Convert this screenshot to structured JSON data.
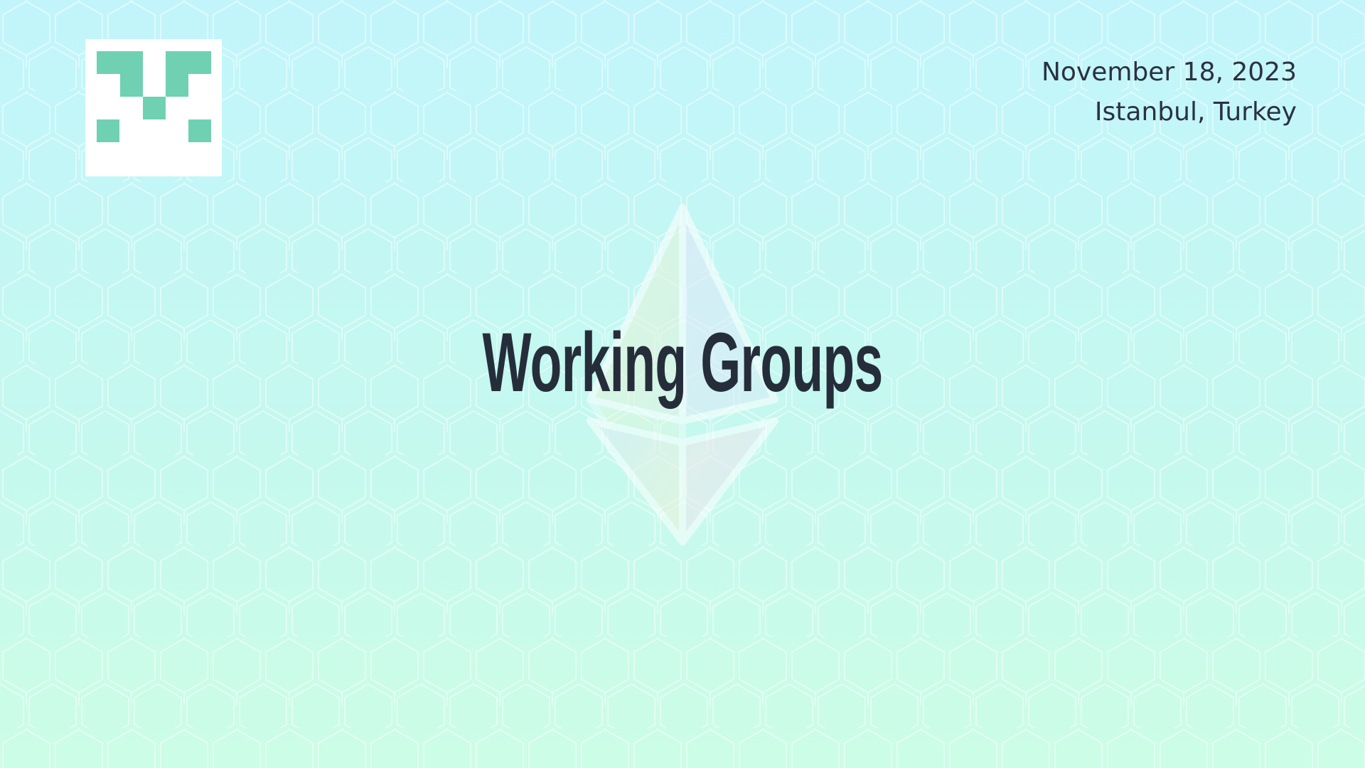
{
  "slide": {
    "title": "Working Groups",
    "date": "November 18, 2023",
    "location": "Istanbul, Turkey"
  },
  "icons": {
    "brand_logo": "pixel-v-logo-icon",
    "background_logo": "ethereum-diamond-icon",
    "background_pattern": "hexagon-star-pattern"
  },
  "colors": {
    "background_top": "#c2f5fb",
    "background_bottom": "#ccfde6",
    "text": "#262d3a",
    "logo_green": "#6fd1b2",
    "logo_background": "#ffffff"
  }
}
